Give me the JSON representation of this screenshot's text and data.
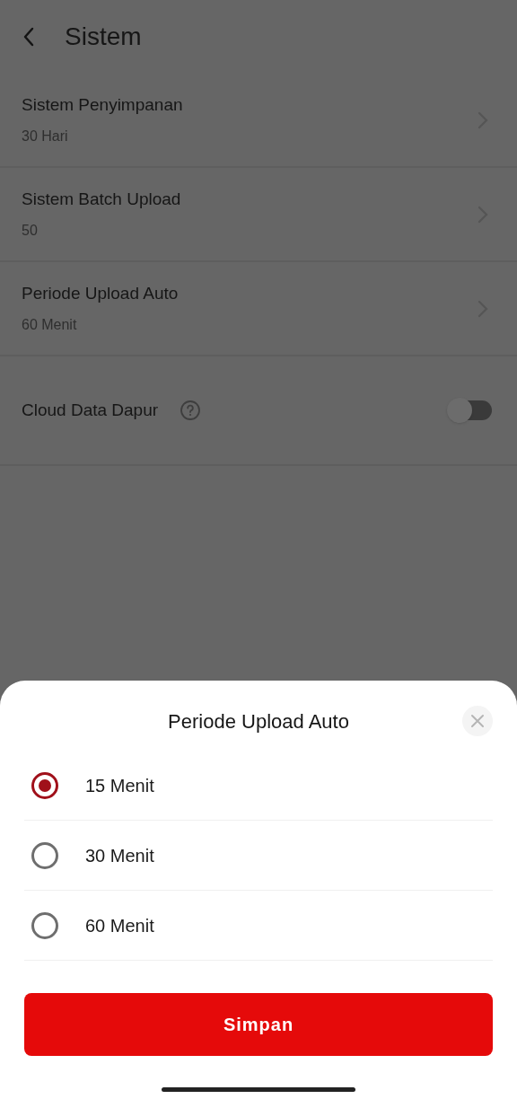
{
  "header": {
    "title": "Sistem"
  },
  "settings": [
    {
      "kind": "link",
      "label": "Sistem Penyimpanan",
      "value": "30 Hari"
    },
    {
      "kind": "link",
      "label": "Sistem Batch Upload",
      "value": "50"
    },
    {
      "kind": "link",
      "label": "Periode Upload Auto",
      "value": "60 Menit"
    },
    {
      "kind": "toggle",
      "label": "Cloud Data Dapur",
      "on": false
    }
  ],
  "sheet": {
    "title": "Periode Upload Auto",
    "options": [
      {
        "label": "15 Menit",
        "selected": true
      },
      {
        "label": "30 Menit",
        "selected": false
      },
      {
        "label": "60 Menit",
        "selected": false
      }
    ],
    "button": "Simpan"
  }
}
